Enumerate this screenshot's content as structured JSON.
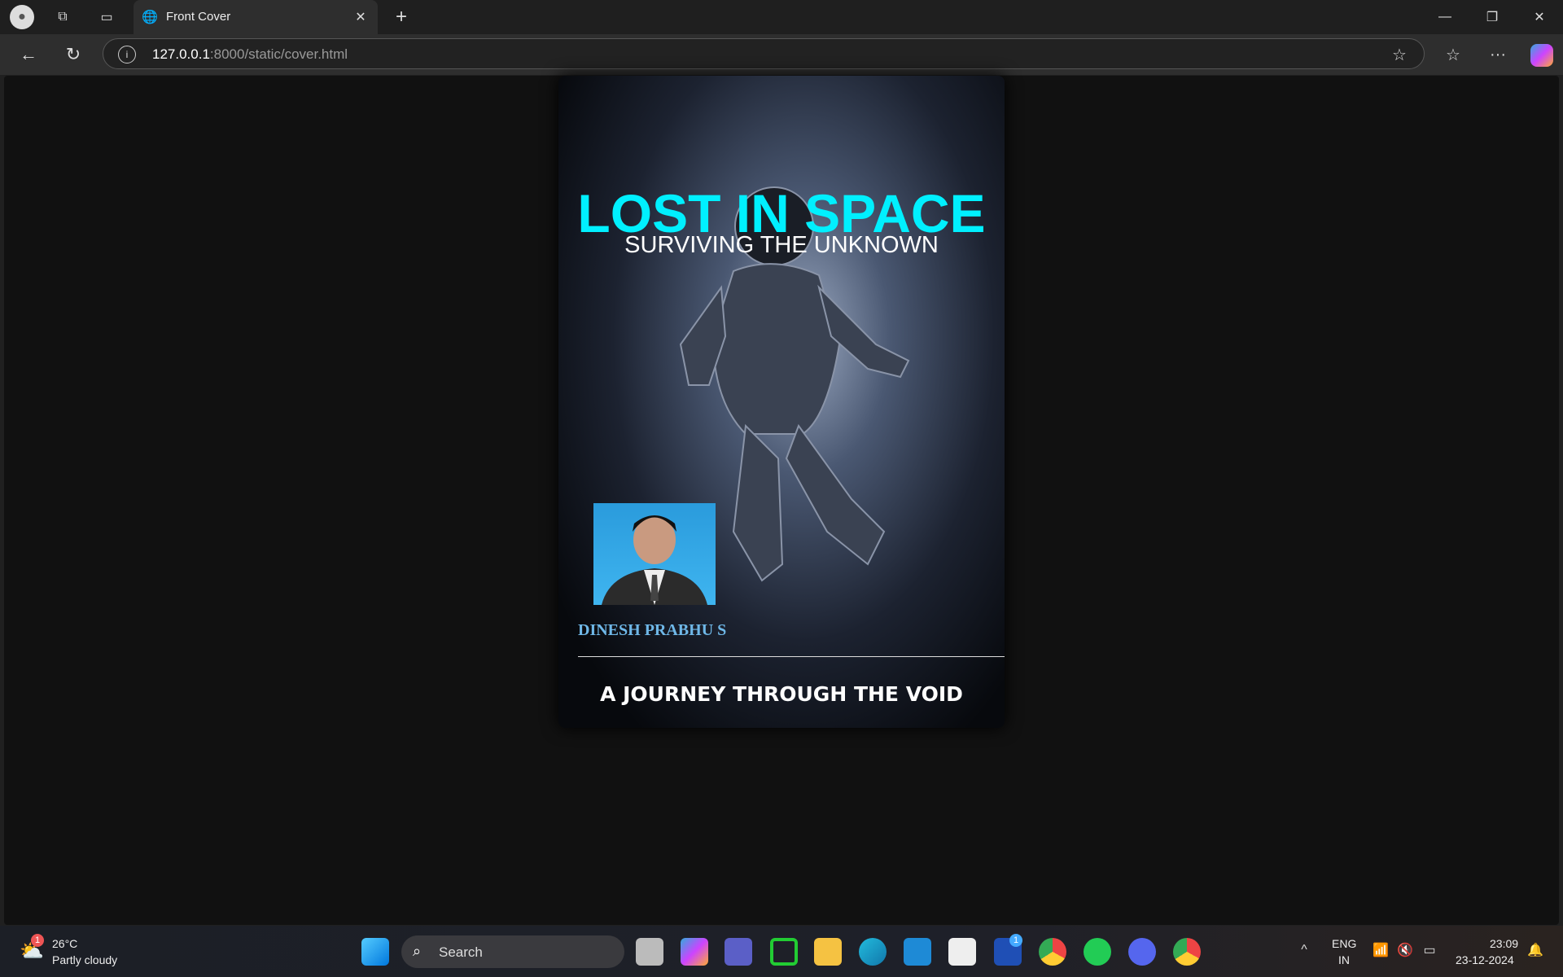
{
  "browser": {
    "tab_title": "Front Cover",
    "url_host": "127.0.0.1",
    "url_rest": ":8000/static/cover.html"
  },
  "cover": {
    "title": "LOST IN SPACE",
    "subtitle": "SURVIVING THE UNKNOWN",
    "author": "DINESH PRABHU S",
    "tagline": "A JOURNEY THROUGH THE VOID"
  },
  "taskbar": {
    "weather_temp": "26°C",
    "weather_desc": "Partly cloudy",
    "weather_badge": "1",
    "search": "Search",
    "lang1": "ENG",
    "lang2": "IN",
    "time": "23:09",
    "date": "23-12-2024",
    "app_badge": "1"
  }
}
